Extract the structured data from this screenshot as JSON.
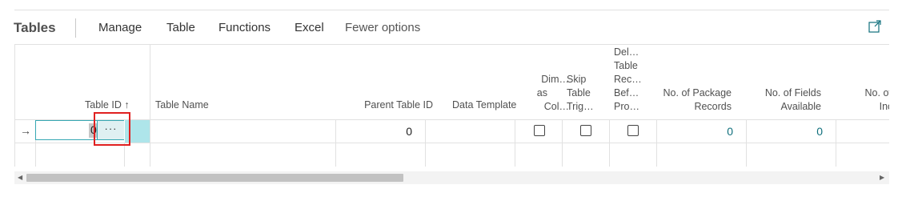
{
  "toolbar": {
    "title": "Tables",
    "actions": [
      "Manage",
      "Table",
      "Functions",
      "Excel",
      "Fewer options"
    ]
  },
  "columns": {
    "table_id": "Table ID",
    "table_id_sort": "↑",
    "table_name": "Table Name",
    "parent_table_id": "Parent Table ID",
    "data_template": "Data Template",
    "dim_as_col": [
      "Dim…",
      "as",
      "Col…"
    ],
    "skip_table_trig": [
      "Skip",
      "Table",
      "Trig…"
    ],
    "del_table_rec": [
      "Del…",
      "Table",
      "Rec…",
      "Bef…",
      "Pro…"
    ],
    "no_package_records": [
      "No. of Package",
      "Records"
    ],
    "no_fields_available": [
      "No. of Fields",
      "Available"
    ],
    "no_fields_included": [
      "No. of F",
      "Inclu"
    ]
  },
  "row": {
    "arrow": "→",
    "table_id_value": "0",
    "lookup": "···",
    "parent_table_id": "0",
    "no_package_records": "0",
    "no_fields_available": "0"
  },
  "colors": {
    "accent": "#37a8b3",
    "link": "#0f6f7c",
    "highlight": "#e02020"
  },
  "icons": {
    "expand": "expand-icon",
    "arrow_left": "scroll-left-icon",
    "arrow_right": "scroll-right-icon"
  }
}
